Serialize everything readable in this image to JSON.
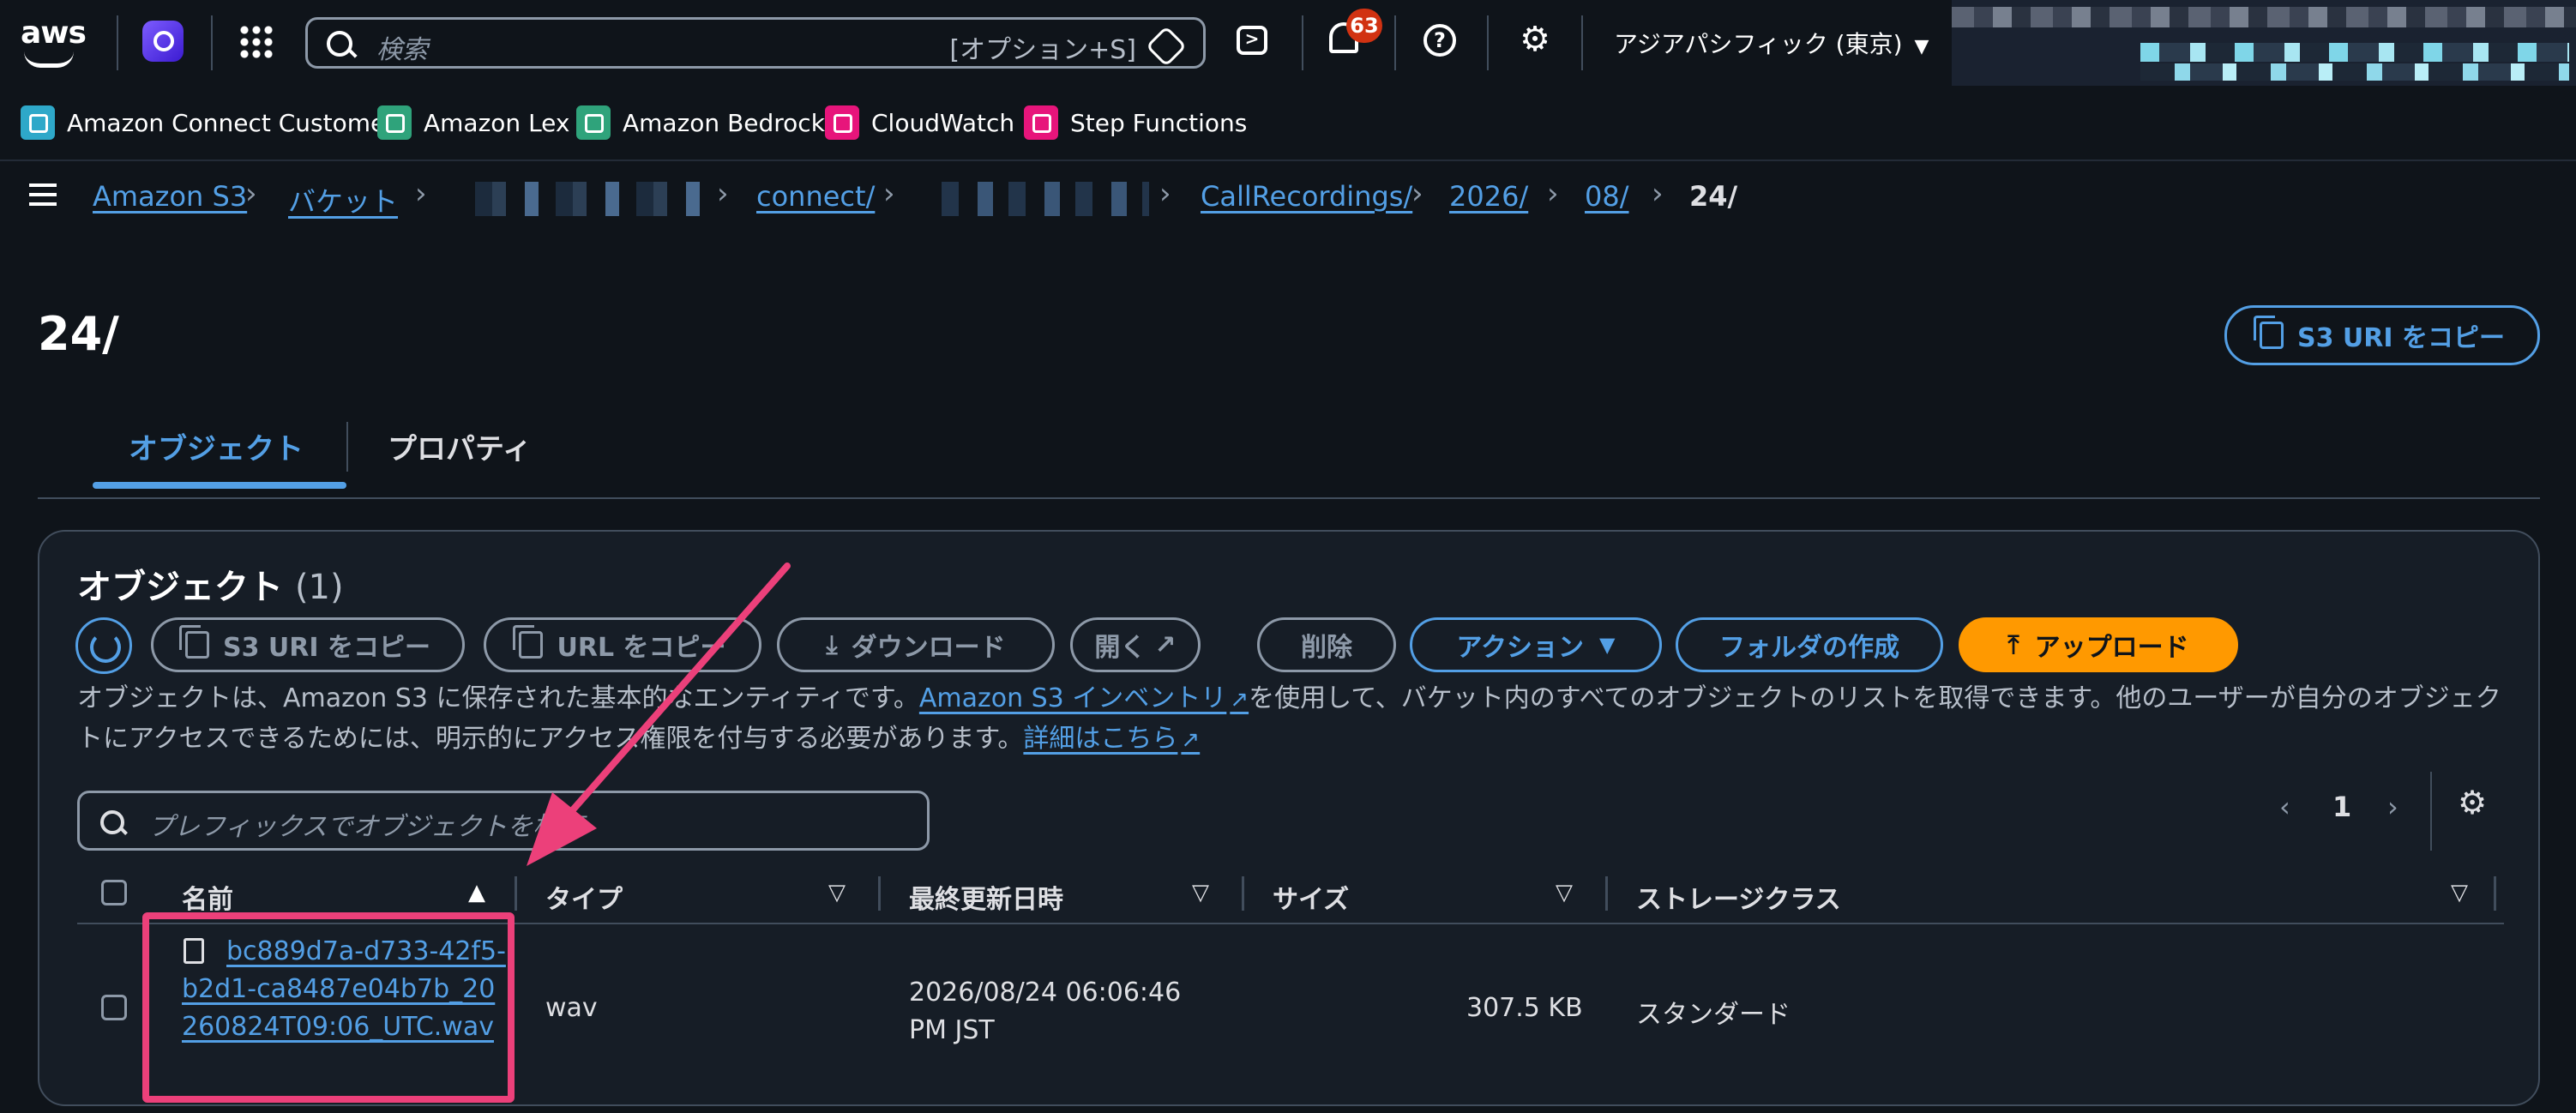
{
  "topnav": {
    "logo": "aws",
    "search_placeholder": "検索",
    "search_shortcut": "[オプション+S]",
    "notifications_count": "63",
    "region": "アジアパシフィック (東京)",
    "icons": [
      "amazon-q-icon",
      "apps-grid-icon",
      "search-icon",
      "cloudshell-icon",
      "bell-icon",
      "help-icon",
      "gear-icon"
    ]
  },
  "favorites": [
    {
      "label": "Amazon Connect Customer",
      "color": "#2ea8c9"
    },
    {
      "label": "Amazon Lex",
      "color": "#2fa37b"
    },
    {
      "label": "Amazon Bedrock",
      "color": "#2fa37b"
    },
    {
      "label": "CloudWatch",
      "color": "#e7157b"
    },
    {
      "label": "Step Functions",
      "color": "#e7157b"
    }
  ],
  "breadcrumb": {
    "items": [
      "Amazon S3",
      "バケット",
      "connect/",
      "CallRecordings/",
      "2026/",
      "08/",
      "24/"
    ]
  },
  "page": {
    "title": "24/",
    "copy_uri_button": "S3 URI をコピー",
    "tabs": [
      "オブジェクト",
      "プロパティ"
    ]
  },
  "objects": {
    "title": "オブジェクト",
    "count": "(1)",
    "buttons": {
      "copy_s3_uri": "S3 URI をコピー",
      "copy_url": "URL をコピー",
      "download": "ダウンロード",
      "open": "開く",
      "delete": "削除",
      "actions": "アクション",
      "create_folder": "フォルダの作成",
      "upload": "アップロード"
    },
    "description_1": "オブジェクトは、Amazon S3 に保存された基本的なエンティティです。",
    "inventory_link": "Amazon S3 インベントリ",
    "description_2": "を使用して、バケット内のすべてのオブジェクトのリストを取得できます。他のユーザーが自分のオブジェクトにアクセスできるためには、明示的にアクセス権限を付与する必要があります。",
    "learn_more": "詳細はこちら",
    "filter_placeholder": "プレフィックスでオブジェクトを検索",
    "page_number": "1",
    "columns": [
      "名前",
      "タイプ",
      "最終更新日時",
      "サイズ",
      "ストレージクラス"
    ],
    "rows": [
      {
        "name": "bc889d7a-d733-42f5-b2d1-ca8487e04b7b_20260824T09:06_UTC.wav",
        "type": "wav",
        "modified": "2026/08/24 06:06:46 PM JST",
        "size": "307.5 KB",
        "storage_class": "スタンダード"
      }
    ]
  },
  "colors": {
    "background": "#0f141a",
    "panel": "#161d26",
    "link": "#539fe5",
    "primary": "#ff9900",
    "annotation": "#ec407a",
    "badge": "#d13212"
  }
}
